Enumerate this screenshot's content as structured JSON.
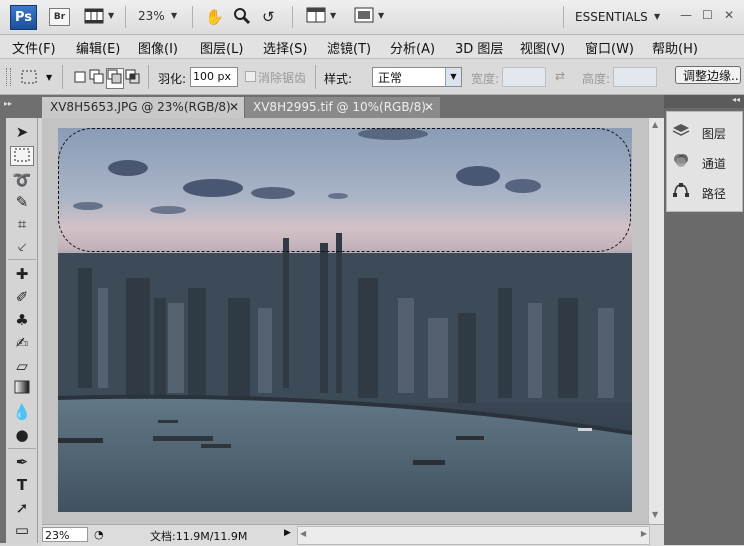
{
  "app": {
    "logo_text": "Ps",
    "bridge_text": "Br",
    "zoom_value": "23%",
    "workspace": "ESSENTIALS"
  },
  "menu": {
    "items": [
      "文件(F)",
      "编辑(E)",
      "图像(I)",
      "图层(L)",
      "选择(S)",
      "滤镜(T)",
      "分析(A)",
      "3D 图层",
      "视图(V)",
      "窗口(W)",
      "帮助(H)"
    ]
  },
  "options": {
    "feather_label": "羽化:",
    "feather_value": "100 px",
    "antialias_label": "消除锯齿",
    "style_label": "样式:",
    "style_value": "正常",
    "width_label": "宽度:",
    "height_label": "高度:",
    "refine_edge_label": "调整边缘..."
  },
  "tabs": [
    {
      "label": "XV8H5653.JPG @ 23%(RGB/8)",
      "active": true
    },
    {
      "label": "XV8H2995.tif @ 10%(RGB/8)",
      "active": false
    }
  ],
  "status": {
    "zoom": "23%",
    "doc_info": "文档:11.9M/11.9M"
  },
  "panels": {
    "items": [
      {
        "label": "图层",
        "icon": "layers-icon"
      },
      {
        "label": "通道",
        "icon": "channels-icon"
      },
      {
        "label": "路径",
        "icon": "paths-icon"
      }
    ]
  },
  "colors": {
    "app_blue": "#1c4f9a",
    "dark_strip": "#6f6f6f",
    "panel_bg": "#e3e3e3"
  }
}
